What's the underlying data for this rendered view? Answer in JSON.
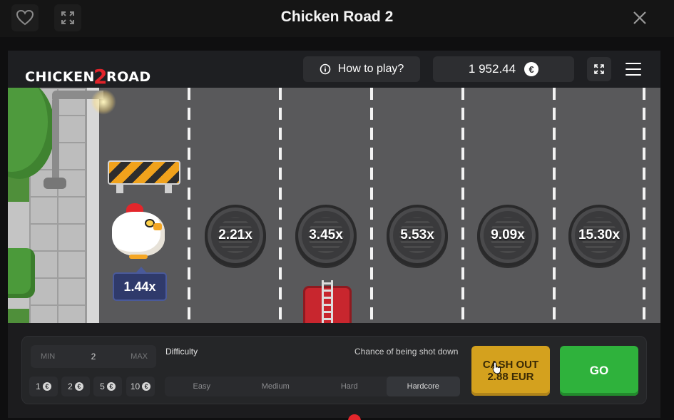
{
  "topbar": {
    "title": "Chicken Road 2",
    "favorite_icon": "heart-icon",
    "expand_icon": "expand-icon",
    "close_icon": "close-icon"
  },
  "game_header": {
    "logo_left": "CHICKEN",
    "logo_number": "2",
    "logo_right": "ROAD",
    "how_to_play": "How to play?",
    "balance": "1 952.44",
    "currency_symbol": "€"
  },
  "scene": {
    "current_multiplier": "1.44x",
    "multipliers": [
      "2.21x",
      "3.45x",
      "5.53x",
      "9.09x",
      "15.30x"
    ]
  },
  "controls": {
    "bet": {
      "min_label": "MIN",
      "value": "2",
      "max_label": "MAX"
    },
    "quick_bets": [
      "1",
      "2",
      "5",
      "10"
    ],
    "difficulty_label": "Difficulty",
    "chance_label": "Chance of being shot down",
    "difficulty_options": [
      "Easy",
      "Medium",
      "Hard",
      "Hardcore"
    ],
    "selected_difficulty": "Hardcore",
    "cashout_line1": "CASH OUT",
    "cashout_line2": "2.88 EUR",
    "go_label": "GO"
  },
  "colors": {
    "cashout": "#d4a11e",
    "go": "#2fb23c",
    "road": "#59595b",
    "brand_red": "#e3262b"
  }
}
